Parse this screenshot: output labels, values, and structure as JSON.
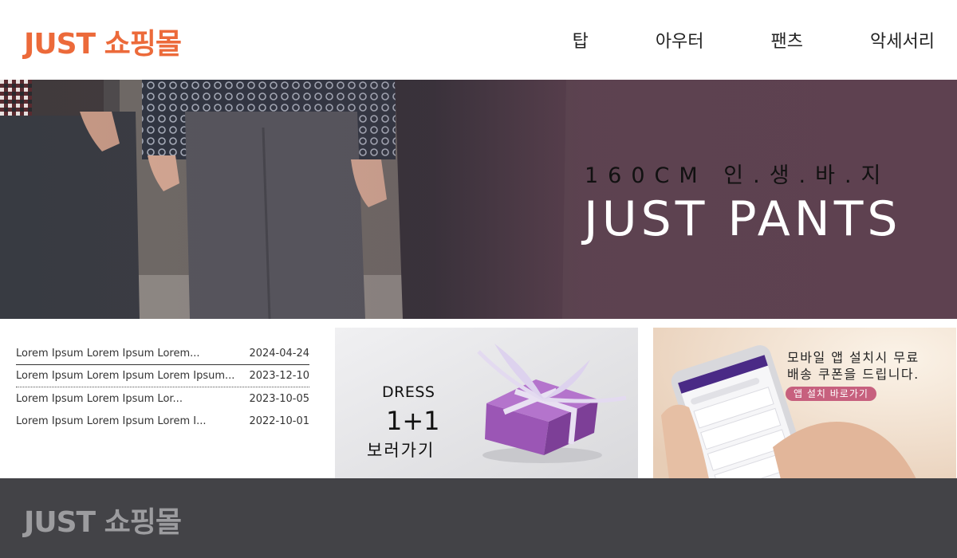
{
  "header": {
    "logo": "JUST 쇼핑몰",
    "nav": [
      "탑",
      "아우터",
      "팬츠",
      "악세서리"
    ]
  },
  "banner": {
    "subtitle": "160CM 인.생.바.지",
    "title": "JUST PANTS"
  },
  "notices": [
    {
      "title": "Lorem Ipsum Lorem Ipsum Lorem...",
      "date": "2024-04-24"
    },
    {
      "title": "Lorem Ipsum Lorem Ipsum Lorem Ipsum...",
      "date": "2023-12-10"
    },
    {
      "title": "Lorem Ipsum Lorem Ipsum Lor...",
      "date": "2023-10-05"
    },
    {
      "title": "Lorem Ipsum Lorem Ipsum Lorem I...",
      "date": "2022-10-01"
    }
  ],
  "promo": {
    "label": "DRESS",
    "offer": "1+1",
    "cta": "보러가기"
  },
  "app_promo": {
    "line1": "모바일 앱 설치시 무료",
    "line2": "배송 쿠폰을 드립니다.",
    "button": "앱 설치 바로가기"
  },
  "footer": {
    "logo": "JUST 쇼핑몰"
  },
  "colors": {
    "brand": "#ec6a3a",
    "banner_overlay": "#5e4150",
    "footer_bg": "#434347",
    "app_button": "#c7607e",
    "gift_box": "#9b56b5"
  }
}
